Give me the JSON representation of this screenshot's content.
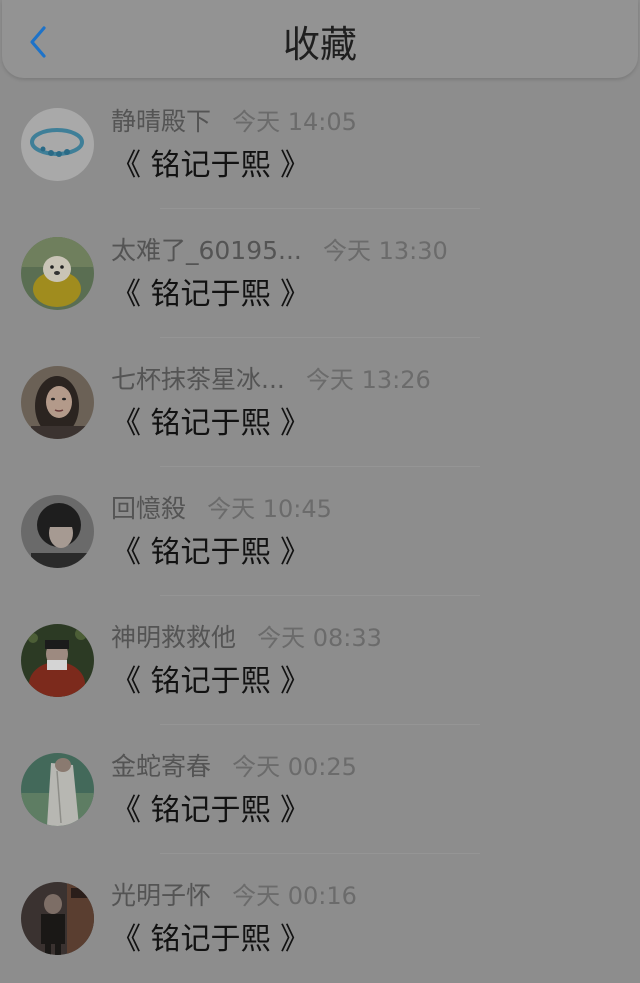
{
  "header": {
    "title": "收藏",
    "back_icon": "chevron-left-icon",
    "accent": "#1e73c9"
  },
  "favorites": [
    {
      "name": "静晴殿下",
      "time": "今天 14:05",
      "content": "《 铭记于熙 》",
      "avatar_icon": "bracelet-avatar"
    },
    {
      "name": "太难了_60195...",
      "time": "今天 13:30",
      "content": "《 铭记于熙 》",
      "avatar_icon": "puppy-avatar"
    },
    {
      "name": "七杯抹茶星冰...",
      "time": "今天 13:26",
      "content": "《 铭记于熙 》",
      "avatar_icon": "woman-portrait-avatar"
    },
    {
      "name": "回憶殺",
      "time": "今天 10:45",
      "content": "《 铭记于熙 》",
      "avatar_icon": "person-portrait-avatar"
    },
    {
      "name": "神明救救他",
      "time": "今天 08:33",
      "content": "《 铭记于熙 》",
      "avatar_icon": "person-red-avatar"
    },
    {
      "name": "金蛇寄春",
      "time": "今天 00:25",
      "content": "《 铭记于熙 》",
      "avatar_icon": "person-green-avatar"
    },
    {
      "name": "光明子怀",
      "time": "今天 00:16",
      "content": "《 铭记于熙 》",
      "avatar_icon": "person-dark-avatar"
    }
  ]
}
